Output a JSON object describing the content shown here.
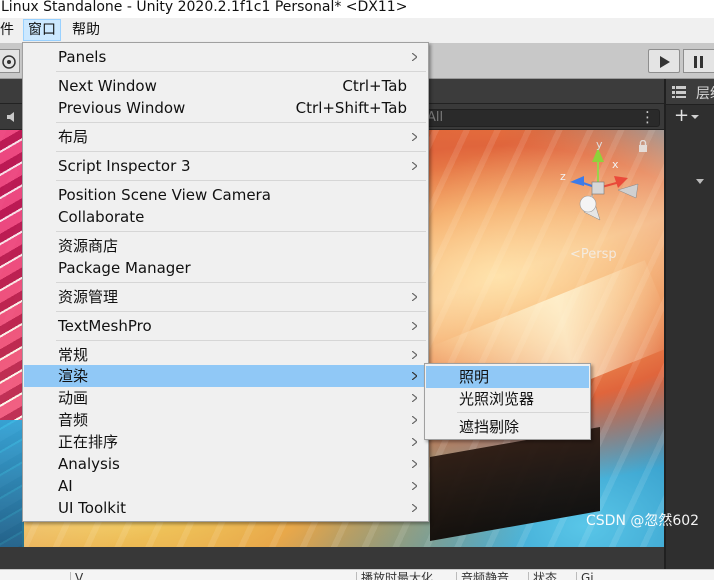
{
  "window": {
    "title": "Linux Standalone - Unity 2020.2.1f1c1 Personal* <DX11>"
  },
  "menubar": {
    "items": [
      {
        "label": "件"
      },
      {
        "label": "窗口"
      },
      {
        "label": "帮助"
      }
    ]
  },
  "scene": {
    "search_placeholder": "All",
    "persp_label": "<Persp",
    "gizmo": {
      "y": "y",
      "x": "x",
      "z": "z"
    }
  },
  "hierarchy": {
    "tab_label": "层级"
  },
  "window_menu": {
    "items": [
      {
        "label": "Panels",
        "submenu": true
      },
      {
        "label": "Next Window",
        "shortcut": "Ctrl+Tab"
      },
      {
        "label": "Previous Window",
        "shortcut": "Ctrl+Shift+Tab"
      },
      {
        "label": "布局",
        "submenu": true
      },
      {
        "label": "Script Inspector 3",
        "submenu": true
      },
      {
        "label": "Position Scene View Camera"
      },
      {
        "label": "Collaborate"
      },
      {
        "label": "资源商店"
      },
      {
        "label": "Package Manager"
      },
      {
        "label": "资源管理",
        "submenu": true
      },
      {
        "label": "TextMeshPro",
        "submenu": true
      },
      {
        "label": "常规",
        "submenu": true
      },
      {
        "label": "渲染",
        "submenu": true,
        "highlighted": true
      },
      {
        "label": "动画",
        "submenu": true
      },
      {
        "label": "音频",
        "submenu": true
      },
      {
        "label": "正在排序",
        "submenu": true
      },
      {
        "label": "Analysis",
        "submenu": true
      },
      {
        "label": "AI",
        "submenu": true
      },
      {
        "label": "UI Toolkit",
        "submenu": true
      }
    ]
  },
  "render_submenu": {
    "items": [
      {
        "label": "照明",
        "highlighted": true
      },
      {
        "label": "光照浏览器"
      },
      {
        "label": "遮挡剔除"
      }
    ]
  },
  "bottom_strip": {
    "cells": [
      "V...",
      "播放时最大化",
      "音频静音",
      "状态",
      "Gi"
    ]
  },
  "watermark": "CSDN @忽然602",
  "colors": {
    "menu_highlight": "#90c8f6",
    "menubar_active": "#cce8ff"
  }
}
